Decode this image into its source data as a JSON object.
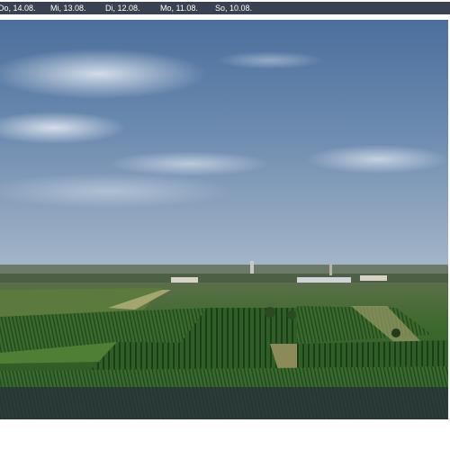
{
  "date_tabs": [
    "Do, 14.08.",
    "Mi, 13.08.",
    "Di, 12.08.",
    "Mo, 11.08.",
    "So, 10.08."
  ],
  "colors": {
    "date_bar": "#3a4150",
    "sky_top": "#4a6e9a",
    "sky_bottom": "#9aaec4",
    "vineyard": "#2a5a25"
  }
}
